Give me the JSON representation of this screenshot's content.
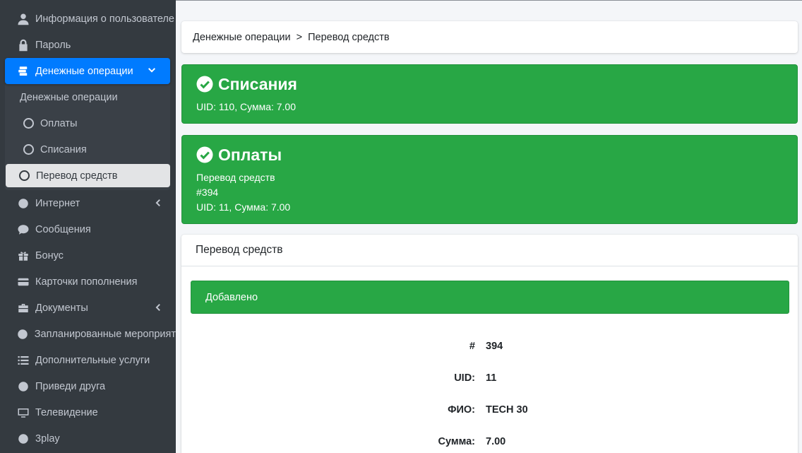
{
  "sidebar": {
    "items_top": [
      {
        "label": "Информация о пользователе",
        "icon": "user-icon"
      },
      {
        "label": "Пароль",
        "icon": "lock-icon"
      }
    ],
    "active": {
      "label": "Денежные операции",
      "icon": "money-icon"
    },
    "submenu": {
      "title": "Денежные операции",
      "items": [
        "Оплаты",
        "Списания",
        "Перевод средств"
      ],
      "selected": "Перевод средств"
    },
    "items_bottom": [
      {
        "label": "Интернет",
        "icon": "globe-icon",
        "caret": true
      },
      {
        "label": "Сообщения",
        "icon": "comment-icon"
      },
      {
        "label": "Бонус",
        "icon": "gift-icon"
      },
      {
        "label": "Карточки пополнения",
        "icon": "credit-card-icon"
      },
      {
        "label": "Документы",
        "icon": "briefcase-icon",
        "caret": true
      },
      {
        "label": "Запланированные мероприят",
        "icon": "circle-icon"
      },
      {
        "label": "Дополнительные услуги",
        "icon": "list-icon"
      },
      {
        "label": "Приведи друга",
        "icon": "circle-icon"
      },
      {
        "label": "Телевидение",
        "icon": "tv-icon"
      },
      {
        "label": "3play",
        "icon": "circle-icon"
      }
    ]
  },
  "breadcrumb": {
    "parent": "Денежные операции",
    "separator": ">",
    "current": "Перевод средств"
  },
  "alerts": {
    "writeoffs": {
      "title": "Списания",
      "text": "UID: 110, Сумма: 7.00"
    },
    "payments": {
      "title": "Оплаты",
      "line1": "Перевод средств",
      "line2": "#394",
      "line3": "UID: 11, Сумма: 7.00"
    }
  },
  "card": {
    "title": "Перевод средств",
    "status": "Добавлено",
    "rows": [
      {
        "label": "#",
        "value": "394"
      },
      {
        "label": "UID:",
        "value": "11"
      },
      {
        "label": "ФИО:",
        "value": "TECH 30"
      },
      {
        "label": "Сумма:",
        "value": "7.00"
      }
    ]
  },
  "colors": {
    "sidebar_bg": "#343a40",
    "active_blue": "#007bff",
    "success_green": "#28a745",
    "page_bg": "#f4f6f9"
  }
}
